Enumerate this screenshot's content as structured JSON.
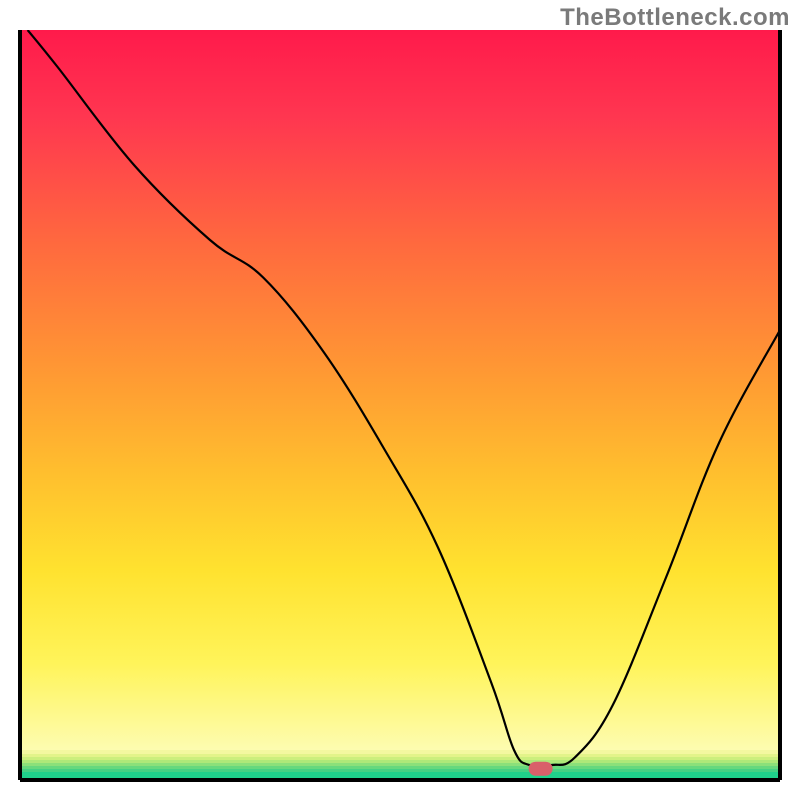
{
  "watermark": "TheBottleneck.com",
  "chart_data": {
    "type": "line",
    "title": "",
    "xlabel": "",
    "ylabel": "",
    "xlim": [
      0,
      100
    ],
    "ylim": [
      0,
      100
    ],
    "grid": false,
    "legend": false,
    "series": [
      {
        "name": "bottleneck-curve",
        "x": [
          1,
          5,
          15,
          25,
          32,
          40,
          48,
          55,
          62,
          65,
          67,
          70,
          73,
          78,
          85,
          92,
          100
        ],
        "y": [
          100,
          95,
          82,
          72,
          67,
          57,
          44,
          31,
          13,
          4,
          2,
          2,
          3,
          10,
          27,
          45,
          60
        ]
      }
    ],
    "marker": {
      "name": "optimal-point",
      "x": 68.5,
      "y": 1.5,
      "color": "#d9606a"
    },
    "background_bands_note": "vertical gradient from red (top) through orange/yellow to green (bottom), with green concentrated in bottom ~4% of plot",
    "axes": {
      "frame_color": "#000000",
      "frame_width": 3
    }
  }
}
